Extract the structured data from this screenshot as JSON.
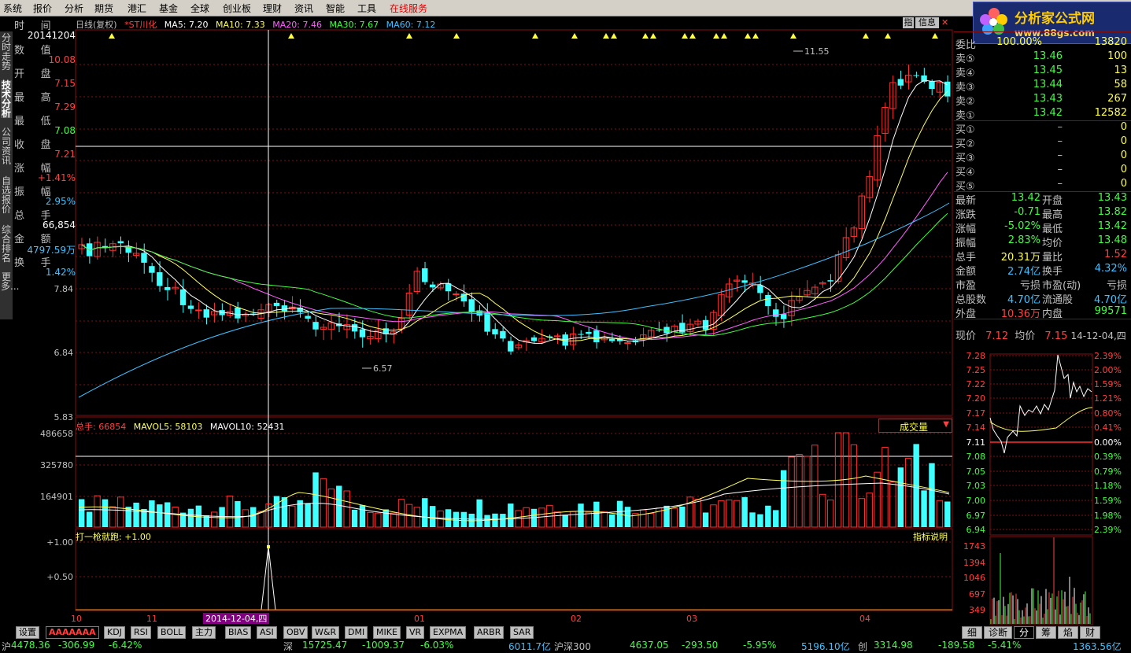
{
  "menu": [
    "系统",
    "报价",
    "分析",
    "期货",
    "港汇",
    "基金",
    "全球",
    "创业板",
    "理财",
    "资讯",
    "智能",
    "工具",
    "在线服务"
  ],
  "logo": {
    "main": "分析家公式网",
    "url": "www.88gs.com"
  },
  "left_nav": [
    "分时走势",
    "技术分析",
    "公司资讯",
    "自选报价",
    "综合排名",
    "更多..."
  ],
  "chart_header": {
    "period": "日线(复权)",
    "stock": "*ST川化",
    "ma5": "MA5: 7.20",
    "ma10": "MA10: 7.33",
    "ma20": "MA20: 7.46",
    "ma30": "MA30: 7.67",
    "ma60": "MA60: 7.12",
    "btn_zhi": "指",
    "btn_info": "信息"
  },
  "info_panel": {
    "time_label": "时     间",
    "date": "20141204",
    "rows": [
      {
        "label": "数     值",
        "value": "10.08",
        "color": "#ff4040"
      },
      {
        "label": "开     盘",
        "value": "7.15",
        "color": "#ff4040"
      },
      {
        "label": "最     高",
        "value": "7.29",
        "color": "#ff4040"
      },
      {
        "label": "最     低",
        "value": "7.08",
        "color": "#40ff40"
      },
      {
        "label": "收     盘",
        "value": "7.21",
        "color": "#ff4040"
      },
      {
        "label": "涨     幅",
        "value": "+1.41%",
        "color": "#ff4040"
      },
      {
        "label": "振     幅",
        "value": "2.95%",
        "color": "#40c0ff"
      },
      {
        "label": "总     手",
        "value": "66,854",
        "color": "#ffffff"
      },
      {
        "label": "金     额",
        "value": "4797.59万",
        "color": "#40c0ff"
      },
      {
        "label": "换     手",
        "value": "1.42%",
        "color": "#40c0ff"
      }
    ]
  },
  "price_axis": [
    "7.84",
    "6.84",
    "5.83"
  ],
  "annotations": {
    "high": "11.55",
    "low": "6.57"
  },
  "volume_header": {
    "total": "总手: 66854",
    "mavol5": "MAVOL5: 58103",
    "mavol10": "MAVOL10: 52431",
    "selector": "成交量"
  },
  "volume_axis": [
    "486658",
    "325780",
    "164901"
  ],
  "indicator": {
    "name": "打一枪就跑: +1.00",
    "axis": [
      "+1.00",
      "+0.50"
    ],
    "btn": "指标说明"
  },
  "x_axis": [
    "10",
    "11",
    "2014-12-04,四",
    "01",
    "02",
    "03",
    "04"
  ],
  "bottom_tabs": [
    "设置",
    "AAAAAAA",
    "KDJ",
    "RSI",
    "BOLL",
    "主力",
    "BIAS",
    "ASI",
    "OBV",
    "W&R",
    "DMI",
    "MIKE",
    "VR",
    "EXPMA",
    "ARBR",
    "SAR"
  ],
  "quotes": {
    "committee_ratio": "委比",
    "committee_val": "100.00%",
    "committee_diff": "13820",
    "sell": [
      {
        "label": "卖⑤",
        "price": "13.46",
        "vol": "100"
      },
      {
        "label": "卖④",
        "price": "13.45",
        "vol": "13"
      },
      {
        "label": "卖③",
        "price": "13.44",
        "vol": "58"
      },
      {
        "label": "卖②",
        "price": "13.43",
        "vol": "267"
      },
      {
        "label": "卖①",
        "price": "13.42",
        "vol": "12582"
      }
    ],
    "buy": [
      {
        "label": "买①",
        "price": "–",
        "vol": "0"
      },
      {
        "label": "买②",
        "price": "–",
        "vol": "0"
      },
      {
        "label": "买③",
        "price": "–",
        "vol": "0"
      },
      {
        "label": "买④",
        "price": "–",
        "vol": "0"
      },
      {
        "label": "买⑤",
        "price": "–",
        "vol": "0"
      }
    ],
    "stats": [
      {
        "k1": "最新",
        "v1": "13.42",
        "c1": "#40ff40",
        "k2": "开盘",
        "v2": "13.43",
        "c2": "#40ff40"
      },
      {
        "k1": "涨跌",
        "v1": "-0.71",
        "c1": "#40ff40",
        "k2": "最高",
        "v2": "13.82",
        "c2": "#40ff40"
      },
      {
        "k1": "涨幅",
        "v1": "-5.02%",
        "c1": "#40ff40",
        "k2": "最低",
        "v2": "13.42",
        "c2": "#40ff40"
      },
      {
        "k1": "振幅",
        "v1": "2.83%",
        "c1": "#40ff40",
        "k2": "均价",
        "v2": "13.48",
        "c2": "#40ff40"
      },
      {
        "k1": "总手",
        "v1": "20.31万",
        "c1": "#ffff40",
        "k2": "量比",
        "v2": "1.52",
        "c2": "#ff4040"
      },
      {
        "k1": "金额",
        "v1": "2.74亿",
        "c1": "#40c0ff",
        "k2": "换手",
        "v2": "4.32%",
        "c2": "#40c0ff"
      },
      {
        "k1": "市盈",
        "v1": "亏损",
        "c1": "#c0c0c0",
        "k2": "市盈(动)",
        "v2": "亏损",
        "c2": "#c0c0c0"
      },
      {
        "k1": "总股数",
        "v1": "4.70亿",
        "c1": "#40c0ff",
        "k2": "流通股",
        "v2": "4.70亿",
        "c2": "#40c0ff"
      },
      {
        "k1": "外盘",
        "v1": "10.36万",
        "c1": "#ff4040",
        "k2": "内盘",
        "v2": "99571",
        "c2": "#40ff40"
      }
    ]
  },
  "mini": {
    "now_label": "现价",
    "now": "7.12",
    "avg_label": "均价",
    "avg": "7.15",
    "date": "14-12-04,四",
    "left_axis": [
      "7.28",
      "7.25",
      "7.22",
      "7.20",
      "7.17",
      "7.14",
      "7.11",
      "7.08",
      "7.05",
      "7.03",
      "7.00",
      "6.97",
      "6.94"
    ],
    "right_axis": [
      "2.39%",
      "2.00%",
      "1.59%",
      "1.21%",
      "0.80%",
      "0.41%",
      "0.00%",
      "0.39%",
      "0.79%",
      "1.18%",
      "1.59%",
      "1.98%",
      "2.39%"
    ],
    "vol_axis": [
      "1743",
      "1394",
      "1046",
      "697",
      "349"
    ],
    "tabs": [
      "细",
      "诊断",
      "分",
      "筹",
      "焰",
      "财"
    ]
  },
  "ticker": [
    {
      "t": "沪",
      "c": "#c0c0c0"
    },
    {
      "t": "4478.36",
      "c": "#40ff40"
    },
    {
      "t": "-306.99",
      "c": "#40ff40"
    },
    {
      "t": "-6.42%",
      "c": "#40ff40"
    },
    {
      "t": "深",
      "c": "#c0c0c0"
    },
    {
      "t": "15725.47",
      "c": "#40ff40"
    },
    {
      "t": "-1009.37",
      "c": "#40ff40"
    },
    {
      "t": "-6.03%",
      "c": "#40ff40"
    },
    {
      "t": "6011.7亿",
      "c": "#40c0ff"
    },
    {
      "t": "沪深300",
      "c": "#c0c0c0"
    },
    {
      "t": "4637.05",
      "c": "#40ff40"
    },
    {
      "t": "-293.50",
      "c": "#40ff40"
    },
    {
      "t": "-5.95%",
      "c": "#40ff40"
    },
    {
      "t": "5196.10亿",
      "c": "#40c0ff"
    },
    {
      "t": "创",
      "c": "#c0c0c0"
    },
    {
      "t": "3314.98",
      "c": "#40ff40"
    },
    {
      "t": "-189.58",
      "c": "#40ff40"
    },
    {
      "t": "-5.41%",
      "c": "#40ff40"
    },
    {
      "t": "1363.56亿",
      "c": "#40c0ff"
    }
  ],
  "colors": {
    "up": "#ff3030",
    "down": "#40ffff",
    "ma5": "#ffffff",
    "ma10": "#ffff60",
    "ma20": "#ff60ff",
    "ma30": "#40ff40",
    "ma60": "#40c0ff",
    "grid": "#801010"
  }
}
